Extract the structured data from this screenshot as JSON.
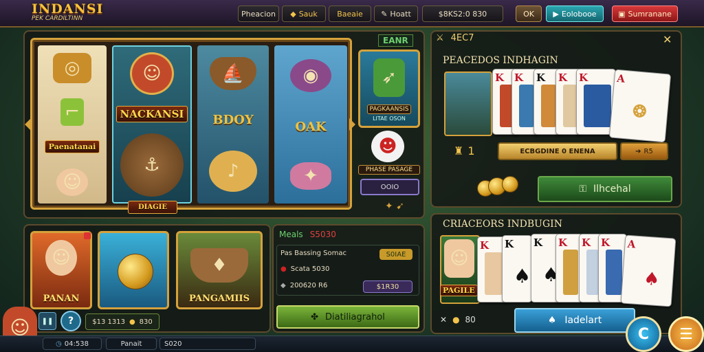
{
  "header": {
    "logo_line1": "INDANSI",
    "logo_line2": "PEK CARDILTINN",
    "pill1": "Pheacion",
    "pill2": "Sauk",
    "pill3": "Baeaie",
    "pill4": "Hoatt",
    "balance": "$8KS2:0 830",
    "btn_ok": "OK",
    "btn_teal": "Eolobooe",
    "btn_red": "Sumranane"
  },
  "slot": {
    "reel2_banner": "NACKANSI",
    "reel3_word": "BDOY",
    "reel4_word": "OAK",
    "reel1_banner": "Paenatanai",
    "label_top": "EANR",
    "side_card_label": "PAGKAANSIS",
    "side_card_sub": "LITAE OSON",
    "side_tag": "PHASE PASAGE",
    "side_btn": "OOIO",
    "bottom_plaque": "DIAGIE"
  },
  "thumbs": [
    {
      "caption": "PANAN"
    },
    {
      "caption": ""
    },
    {
      "caption": "PANGAMIIS"
    }
  ],
  "leftbar": {
    "value": "$13 1313",
    "coins": "830",
    "bottom1": "04:538",
    "bottom2": "Panait",
    "bottom3": "S020"
  },
  "info": {
    "meals_label": "Meals",
    "meals_value": "S5030",
    "row1_text": "Pas Bassing Somac",
    "row1_btn": "S0IAE",
    "row2_text": "Scata 5030",
    "row3_text": "200620 R6",
    "row3_btn": "$1R30",
    "main_btn": "Diatiliagrahol"
  },
  "card_panel_top": {
    "header_value": "4EC7",
    "title": "PEACEDOS INDHAGIN",
    "count": "1",
    "mid_btn": "ECBGDINE 0 ENENA",
    "small_btn": "R5",
    "action_btn": "Ilhcehal"
  },
  "card_panel_bottom": {
    "title": "CRIACEORS INDBUGIN",
    "card_banner": "PAGILE",
    "chip_value": "80",
    "main_btn": "Iadelart"
  },
  "colors": {
    "gold": "#d5a23c",
    "teal": "#2aa6b0",
    "green": "#3f8a2a",
    "red": "#c0172a"
  }
}
